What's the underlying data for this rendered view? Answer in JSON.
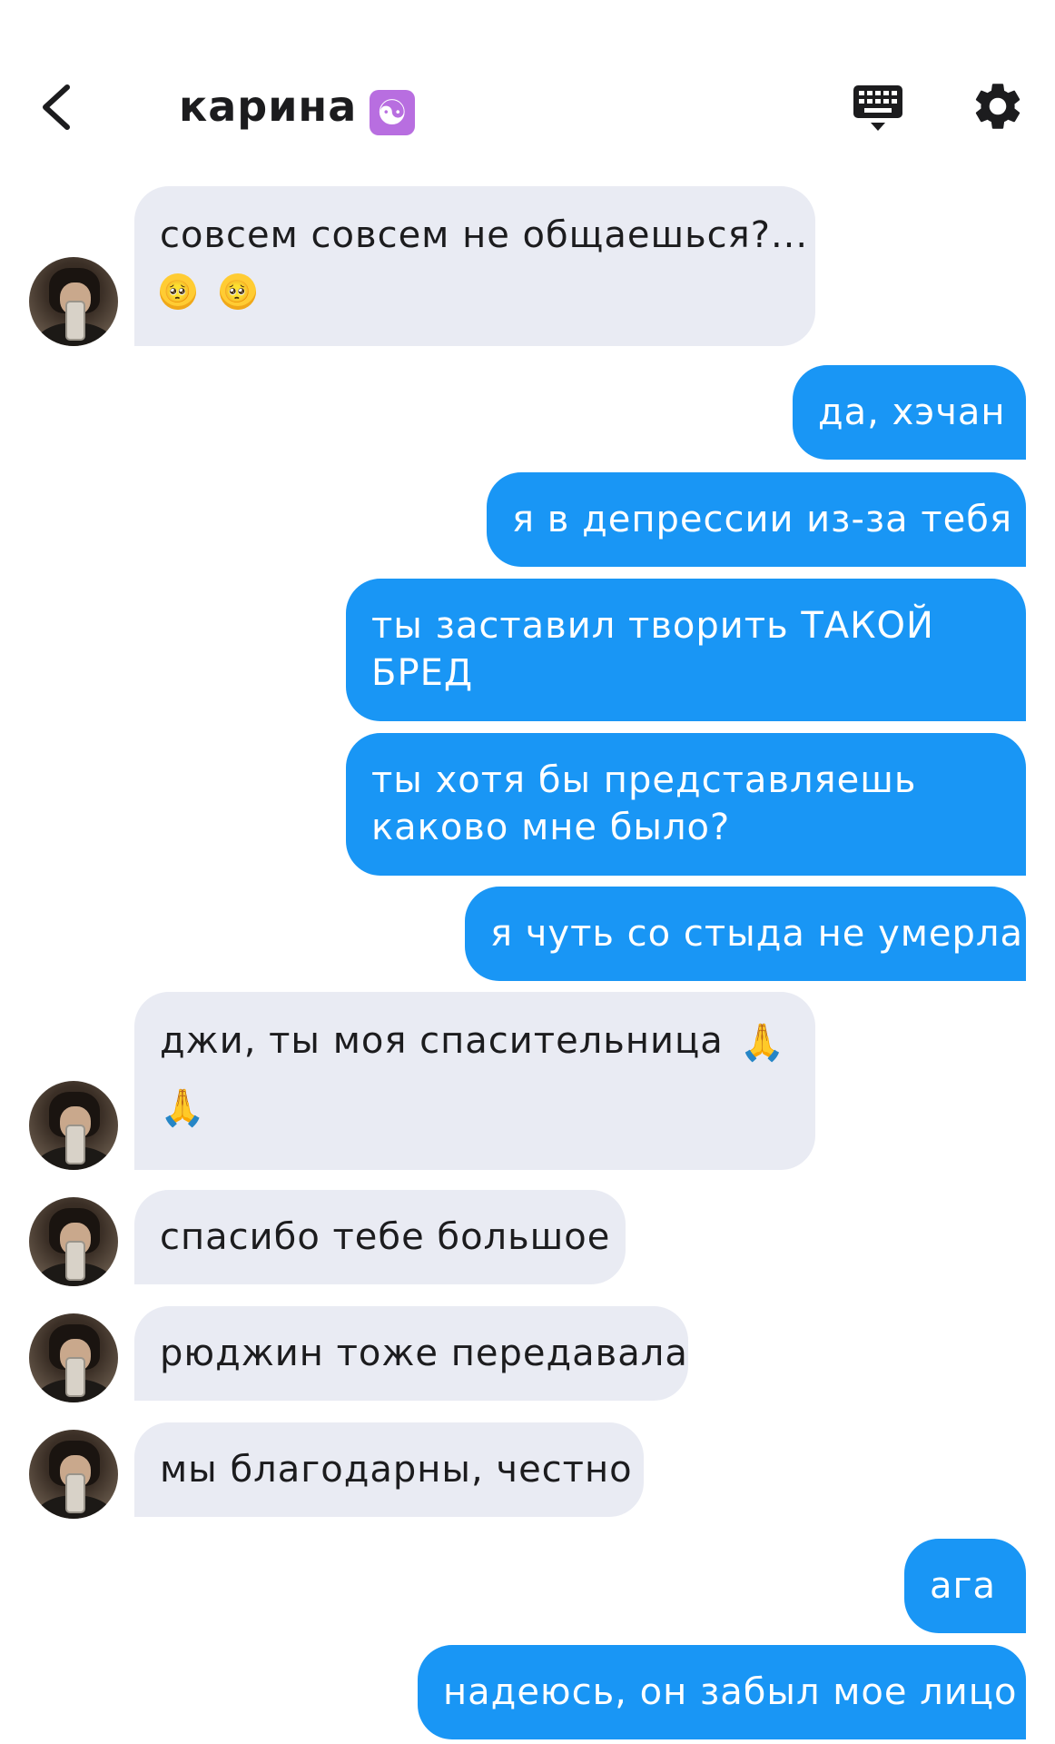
{
  "header": {
    "back_icon": "chevron-left-icon",
    "contact_name": "карина",
    "contact_emoji": "☯",
    "keyboard_icon": "keyboard-icon",
    "settings_icon": "gear-icon"
  },
  "colors": {
    "incoming_bubble": "#e9ebf3",
    "outgoing_bubble": "#1996f5",
    "title_emoji_bg": "#b86ee0"
  },
  "messages": [
    {
      "dir": "in",
      "lines": [
        "совсем совсем не общаешься?..."
      ],
      "emoji_line": [
        "🥺",
        "🥺"
      ]
    },
    {
      "dir": "out",
      "lines": [
        "да, хэчан"
      ]
    },
    {
      "dir": "out",
      "lines": [
        "я в депрессии из-за тебя"
      ]
    },
    {
      "dir": "out",
      "lines": [
        "ты заставил творить ТАКОЙ",
        "БРЕД"
      ]
    },
    {
      "dir": "out",
      "lines": [
        "ты хотя бы представляешь",
        "каково мне было?"
      ]
    },
    {
      "dir": "out",
      "lines": [
        "я чуть со стыда не умерла"
      ]
    },
    {
      "dir": "in",
      "lines": [
        "джи, ты моя спасительница"
      ],
      "inline_emoji": "🙏",
      "emoji_line": [
        "🙏"
      ]
    },
    {
      "dir": "in",
      "lines": [
        "спасибо тебе большое"
      ]
    },
    {
      "dir": "in",
      "lines": [
        "рюджин тоже передавала"
      ]
    },
    {
      "dir": "in",
      "lines": [
        "мы благодарны, честно"
      ]
    },
    {
      "dir": "out",
      "lines": [
        "ага"
      ]
    },
    {
      "dir": "out",
      "lines": [
        "надеюсь, он забыл мое лицо"
      ]
    }
  ]
}
